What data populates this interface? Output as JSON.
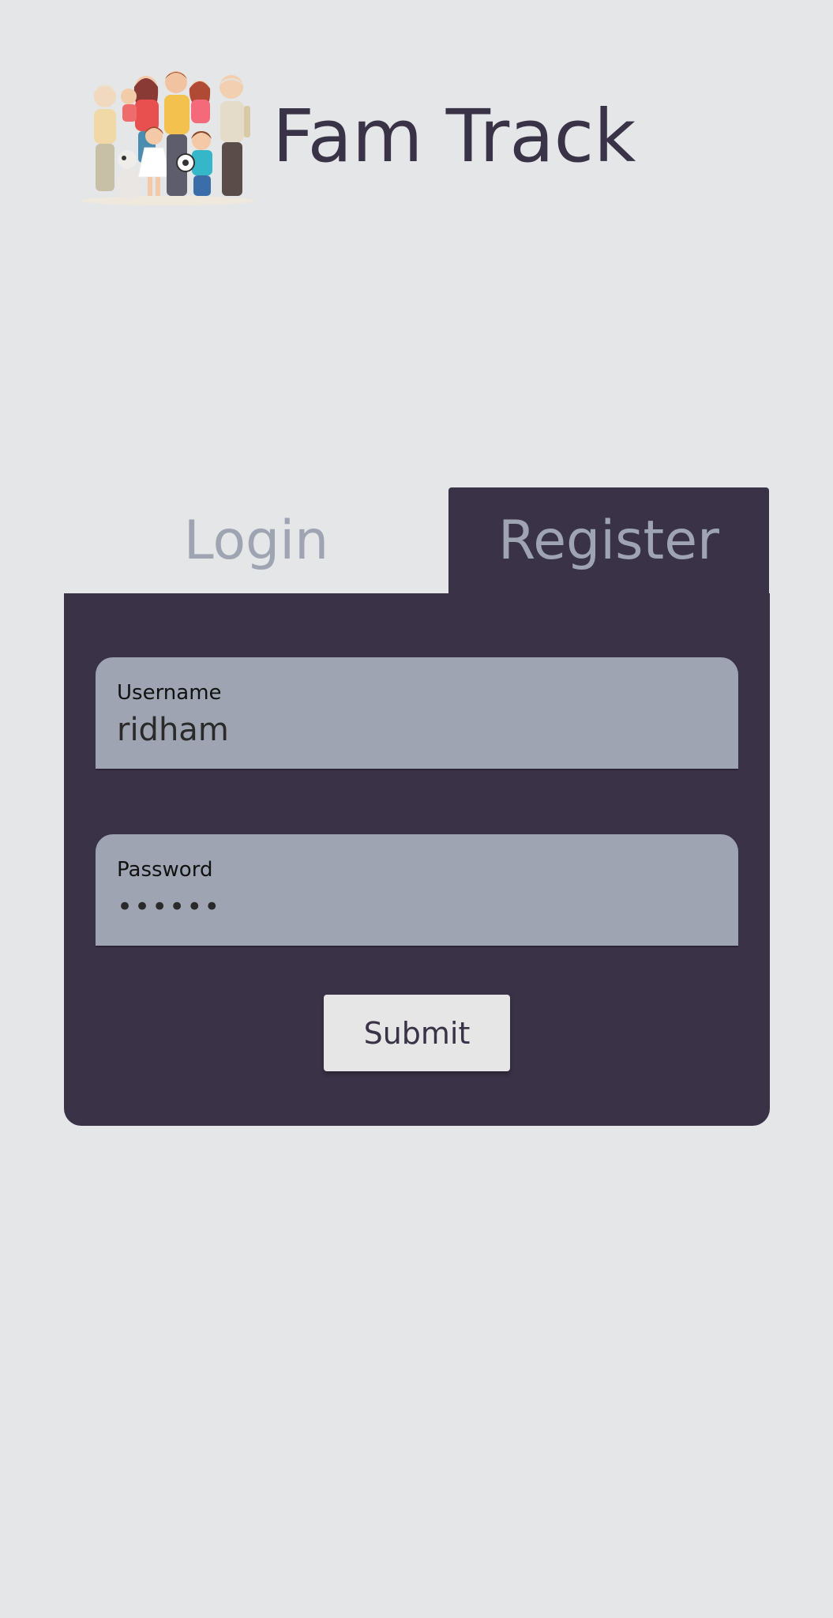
{
  "header": {
    "title": "Fam Track",
    "logo_icon": "family-illustration-icon"
  },
  "tabs": {
    "login_label": "Login",
    "register_label": "Register",
    "active": "register"
  },
  "form": {
    "username": {
      "label": "Username",
      "value": "ridham"
    },
    "password": {
      "label": "Password",
      "value": "••••••"
    },
    "submit_label": "Submit"
  },
  "colors": {
    "background": "#e4e6e8",
    "panel": "#3a3347",
    "field": "#9ea4b2",
    "tab_text": "#9ea4b2",
    "title_text": "#3a3347",
    "button": "#e6e6e6"
  }
}
